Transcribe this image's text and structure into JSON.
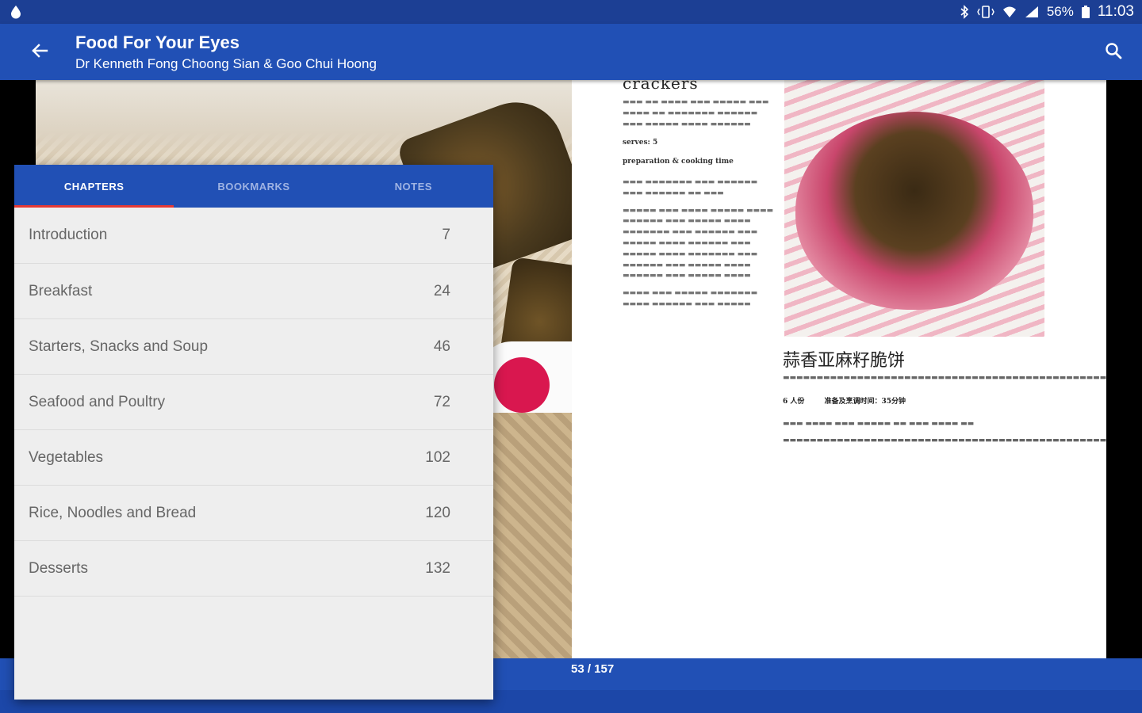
{
  "status_bar": {
    "icons": [
      "notification-drop-icon",
      "bluetooth-icon",
      "vibrate-icon",
      "wifi-icon",
      "signal-icon",
      "battery-icon"
    ],
    "battery": "56%",
    "time": "11:03"
  },
  "app_bar": {
    "title": "Food For Your Eyes",
    "subtitle": "Dr Kenneth Fong Choong Sian & Goo Chui Hoong",
    "back_icon": "arrow-left-icon",
    "search_icon": "search-icon"
  },
  "toc": {
    "tabs": [
      {
        "label": "CHAPTERS",
        "active": true
      },
      {
        "label": "BOOKMARKS",
        "active": false
      },
      {
        "label": "NOTES",
        "active": false
      }
    ],
    "chapters": [
      {
        "title": "Introduction",
        "page": "7"
      },
      {
        "title": "Breakfast",
        "page": "24"
      },
      {
        "title": "Starters, Snacks and Soup",
        "page": "46"
      },
      {
        "title": "Seafood and Poultry",
        "page": "72"
      },
      {
        "title": "Vegetables",
        "page": "102"
      },
      {
        "title": "Rice, Noodles and Bread",
        "page": "120"
      },
      {
        "title": "Desserts",
        "page": "132"
      }
    ]
  },
  "book_page": {
    "heading": "crackers",
    "serves": "serves: 5",
    "prep_time": "preparation & cooking time",
    "chinese_title": "蒜香亚麻籽脆饼",
    "chinese_serves": "6 人份",
    "chinese_time": "准备及烹调时间：35分钟"
  },
  "page_indicator": "53 / 157",
  "colors": {
    "app_bar": "#2150b5",
    "status_bar": "#1c3f94",
    "tab_indicator": "#e53935",
    "panel_bg": "#eeeeee"
  }
}
